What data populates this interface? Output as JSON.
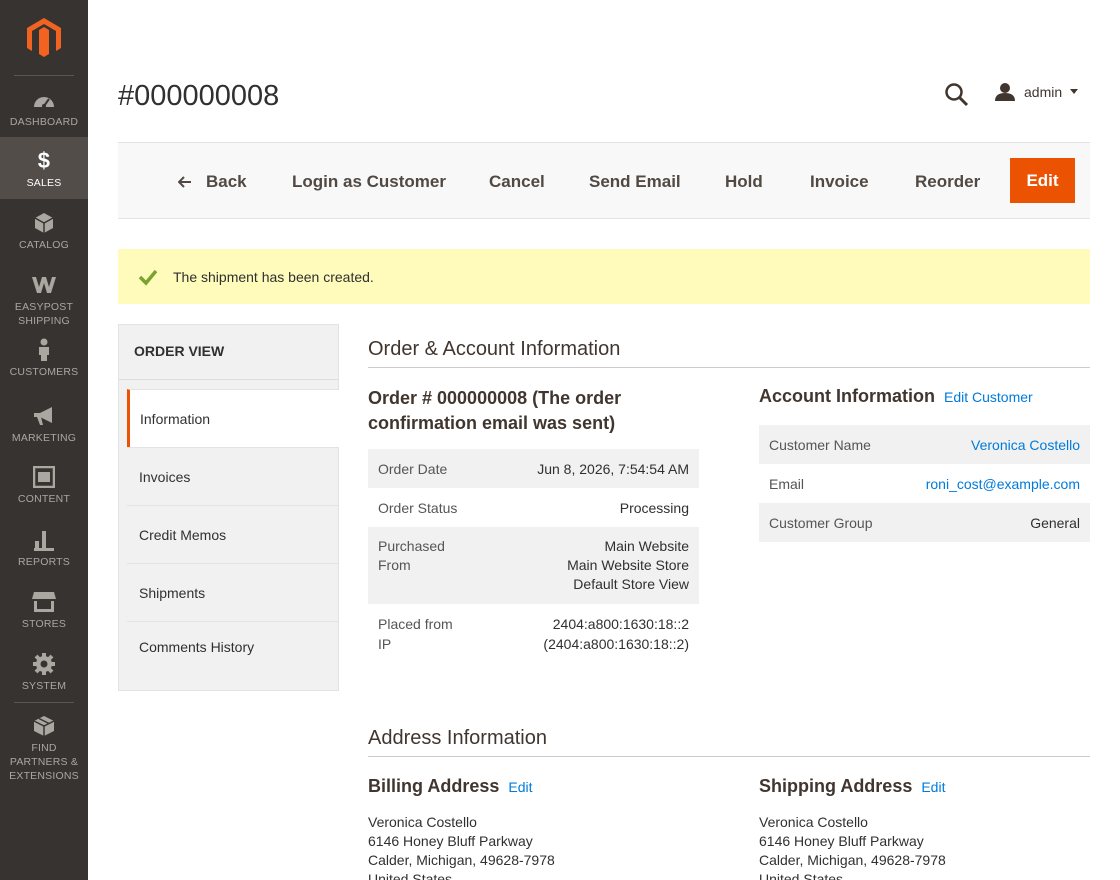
{
  "sidebar": {
    "items": [
      {
        "label": "DASHBOARD",
        "icon": "dashboard-icon"
      },
      {
        "label": "SALES",
        "icon": "dollar-icon",
        "active": true
      },
      {
        "label": "CATALOG",
        "icon": "box-icon"
      },
      {
        "label": "EASYPOST SHIPPING",
        "icon": "easypost-icon"
      },
      {
        "label": "CUSTOMERS",
        "icon": "person-icon"
      },
      {
        "label": "MARKETING",
        "icon": "megaphone-icon"
      },
      {
        "label": "CONTENT",
        "icon": "layout-icon"
      },
      {
        "label": "REPORTS",
        "icon": "bar-chart-icon"
      },
      {
        "label": "STORES",
        "icon": "store-icon"
      },
      {
        "label": "SYSTEM",
        "icon": "gear-icon"
      },
      {
        "label": "FIND PARTNERS & EXTENSIONS",
        "icon": "cubes-icon"
      }
    ]
  },
  "header": {
    "title": "#000000008",
    "user": "admin"
  },
  "actions": {
    "back": "Back",
    "login_as_customer": "Login as Customer",
    "cancel": "Cancel",
    "send_email": "Send Email",
    "hold": "Hold",
    "invoice": "Invoice",
    "reorder": "Reorder",
    "edit": "Edit"
  },
  "message": "The shipment has been created.",
  "tabs": {
    "title": "ORDER VIEW",
    "items": [
      "Information",
      "Invoices",
      "Credit Memos",
      "Shipments",
      "Comments History"
    ]
  },
  "order_account": {
    "heading": "Order & Account Information",
    "order_title": "Order # 000000008 (The order confirmation email was sent)",
    "order_rows": {
      "date_label": "Order Date",
      "date_value": "Jun 8, 2026, 7:54:54 AM",
      "status_label": "Order Status",
      "status_value": "Processing",
      "purchased_label": "Purchased From",
      "purchased_value_1": "Main Website",
      "purchased_value_2": "Main Website Store",
      "purchased_value_3": "Default Store View",
      "ip_label": "Placed from IP",
      "ip_value_1": "2404:a800:1630:18::2",
      "ip_value_2": "(2404:a800:1630:18::2)"
    },
    "account_title": "Account Information",
    "edit_customer": "Edit Customer",
    "account_rows": {
      "name_label": "Customer Name",
      "name_value": "Veronica Costello",
      "email_label": "Email",
      "email_value": "roni_cost@example.com",
      "group_label": "Customer Group",
      "group_value": "General"
    }
  },
  "address": {
    "heading": "Address Information",
    "billing_title": "Billing Address",
    "shipping_title": "Shipping Address",
    "edit": "Edit",
    "billing": {
      "name": "Veronica Costello",
      "street": "6146 Honey Bluff Parkway",
      "city": "Calder, Michigan, 49628-7978",
      "country": "United States"
    },
    "shipping": {
      "name": "Veronica Costello",
      "street": "6146 Honey Bluff Parkway",
      "city": "Calder, Michigan, 49628-7978",
      "country": "United States"
    }
  },
  "colors": {
    "sidebar_bg": "#373330",
    "accent": "#eb5202",
    "link": "#007bdb",
    "message_bg": "#fffbbb"
  }
}
